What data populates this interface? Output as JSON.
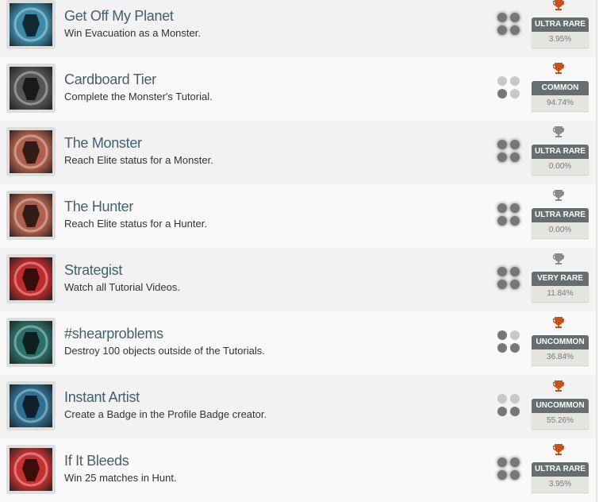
{
  "colors": {
    "earned_trophy": "#c8501a",
    "unearned_trophy": "#8a8a8a",
    "tier_bg": "#666e70"
  },
  "achievements": [
    {
      "title": "Get Off My Planet",
      "description": "Win Evacuation as a Monster.",
      "tier": "ULTRA RARE",
      "percent": "3.95%",
      "earned": true,
      "rarity_dots": 4,
      "icon": "monster-silhouette-icon",
      "icon_color": "#3a8aa8"
    },
    {
      "title": "Cardboard Tier",
      "description": "Complete the Monster's Tutorial.",
      "tier": "COMMON",
      "percent": "94.74%",
      "earned": true,
      "rarity_dots": 1,
      "icon": "cardboard-crest-icon",
      "icon_color": "#555555"
    },
    {
      "title": "The Monster",
      "description": "Reach Elite status for a Monster.",
      "tier": "ULTRA RARE",
      "percent": "0.00%",
      "earned": false,
      "rarity_dots": 4,
      "icon": "monster-claw-icon",
      "icon_color": "#b0604a"
    },
    {
      "title": "The Hunter",
      "description": "Reach Elite status for a Hunter.",
      "tier": "ULTRA RARE",
      "percent": "0.00%",
      "earned": false,
      "rarity_dots": 4,
      "icon": "hunter-figure-icon",
      "icon_color": "#b0604a"
    },
    {
      "title": "Strategist",
      "description": "Watch all Tutorial Videos.",
      "tier": "VERY RARE",
      "percent": "11.84%",
      "earned": false,
      "rarity_dots": 4,
      "icon": "eye-icon",
      "icon_color": "#c02a2a"
    },
    {
      "title": "#shearproblems",
      "description": "Destroy 100 objects outside of the Tutorials.",
      "tier": "UNCOMMON",
      "percent": "36.84%",
      "earned": true,
      "rarity_dots": 3,
      "icon": "shear-blast-icon",
      "icon_color": "#2a6f6a"
    },
    {
      "title": "Instant Artist",
      "description": "Create a Badge in the Profile Badge creator.",
      "tier": "UNCOMMON",
      "percent": "55.26%",
      "earned": true,
      "rarity_dots": 2,
      "icon": "artist-splash-icon",
      "icon_color": "#2f6f8f"
    },
    {
      "title": "If It Bleeds",
      "description": "Win 25 matches in Hunt.",
      "tier": "ULTRA RARE",
      "percent": "3.95%",
      "earned": true,
      "rarity_dots": 4,
      "icon": "knife-icon",
      "icon_color": "#c83030"
    }
  ]
}
